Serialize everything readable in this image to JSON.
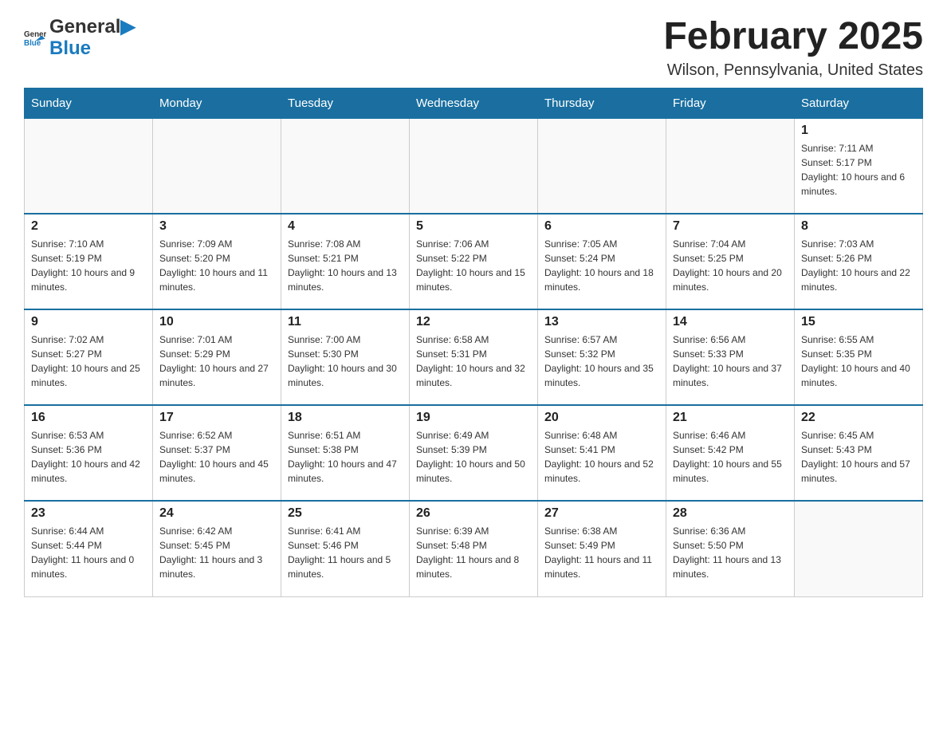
{
  "logo": {
    "text_general": "General",
    "text_blue": "Blue"
  },
  "title": "February 2025",
  "location": "Wilson, Pennsylvania, United States",
  "days_of_week": [
    "Sunday",
    "Monday",
    "Tuesday",
    "Wednesday",
    "Thursday",
    "Friday",
    "Saturday"
  ],
  "weeks": [
    [
      {
        "day": "",
        "info": ""
      },
      {
        "day": "",
        "info": ""
      },
      {
        "day": "",
        "info": ""
      },
      {
        "day": "",
        "info": ""
      },
      {
        "day": "",
        "info": ""
      },
      {
        "day": "",
        "info": ""
      },
      {
        "day": "1",
        "info": "Sunrise: 7:11 AM\nSunset: 5:17 PM\nDaylight: 10 hours and 6 minutes."
      }
    ],
    [
      {
        "day": "2",
        "info": "Sunrise: 7:10 AM\nSunset: 5:19 PM\nDaylight: 10 hours and 9 minutes."
      },
      {
        "day": "3",
        "info": "Sunrise: 7:09 AM\nSunset: 5:20 PM\nDaylight: 10 hours and 11 minutes."
      },
      {
        "day": "4",
        "info": "Sunrise: 7:08 AM\nSunset: 5:21 PM\nDaylight: 10 hours and 13 minutes."
      },
      {
        "day": "5",
        "info": "Sunrise: 7:06 AM\nSunset: 5:22 PM\nDaylight: 10 hours and 15 minutes."
      },
      {
        "day": "6",
        "info": "Sunrise: 7:05 AM\nSunset: 5:24 PM\nDaylight: 10 hours and 18 minutes."
      },
      {
        "day": "7",
        "info": "Sunrise: 7:04 AM\nSunset: 5:25 PM\nDaylight: 10 hours and 20 minutes."
      },
      {
        "day": "8",
        "info": "Sunrise: 7:03 AM\nSunset: 5:26 PM\nDaylight: 10 hours and 22 minutes."
      }
    ],
    [
      {
        "day": "9",
        "info": "Sunrise: 7:02 AM\nSunset: 5:27 PM\nDaylight: 10 hours and 25 minutes."
      },
      {
        "day": "10",
        "info": "Sunrise: 7:01 AM\nSunset: 5:29 PM\nDaylight: 10 hours and 27 minutes."
      },
      {
        "day": "11",
        "info": "Sunrise: 7:00 AM\nSunset: 5:30 PM\nDaylight: 10 hours and 30 minutes."
      },
      {
        "day": "12",
        "info": "Sunrise: 6:58 AM\nSunset: 5:31 PM\nDaylight: 10 hours and 32 minutes."
      },
      {
        "day": "13",
        "info": "Sunrise: 6:57 AM\nSunset: 5:32 PM\nDaylight: 10 hours and 35 minutes."
      },
      {
        "day": "14",
        "info": "Sunrise: 6:56 AM\nSunset: 5:33 PM\nDaylight: 10 hours and 37 minutes."
      },
      {
        "day": "15",
        "info": "Sunrise: 6:55 AM\nSunset: 5:35 PM\nDaylight: 10 hours and 40 minutes."
      }
    ],
    [
      {
        "day": "16",
        "info": "Sunrise: 6:53 AM\nSunset: 5:36 PM\nDaylight: 10 hours and 42 minutes."
      },
      {
        "day": "17",
        "info": "Sunrise: 6:52 AM\nSunset: 5:37 PM\nDaylight: 10 hours and 45 minutes."
      },
      {
        "day": "18",
        "info": "Sunrise: 6:51 AM\nSunset: 5:38 PM\nDaylight: 10 hours and 47 minutes."
      },
      {
        "day": "19",
        "info": "Sunrise: 6:49 AM\nSunset: 5:39 PM\nDaylight: 10 hours and 50 minutes."
      },
      {
        "day": "20",
        "info": "Sunrise: 6:48 AM\nSunset: 5:41 PM\nDaylight: 10 hours and 52 minutes."
      },
      {
        "day": "21",
        "info": "Sunrise: 6:46 AM\nSunset: 5:42 PM\nDaylight: 10 hours and 55 minutes."
      },
      {
        "day": "22",
        "info": "Sunrise: 6:45 AM\nSunset: 5:43 PM\nDaylight: 10 hours and 57 minutes."
      }
    ],
    [
      {
        "day": "23",
        "info": "Sunrise: 6:44 AM\nSunset: 5:44 PM\nDaylight: 11 hours and 0 minutes."
      },
      {
        "day": "24",
        "info": "Sunrise: 6:42 AM\nSunset: 5:45 PM\nDaylight: 11 hours and 3 minutes."
      },
      {
        "day": "25",
        "info": "Sunrise: 6:41 AM\nSunset: 5:46 PM\nDaylight: 11 hours and 5 minutes."
      },
      {
        "day": "26",
        "info": "Sunrise: 6:39 AM\nSunset: 5:48 PM\nDaylight: 11 hours and 8 minutes."
      },
      {
        "day": "27",
        "info": "Sunrise: 6:38 AM\nSunset: 5:49 PM\nDaylight: 11 hours and 11 minutes."
      },
      {
        "day": "28",
        "info": "Sunrise: 6:36 AM\nSunset: 5:50 PM\nDaylight: 11 hours and 13 minutes."
      },
      {
        "day": "",
        "info": ""
      }
    ]
  ]
}
